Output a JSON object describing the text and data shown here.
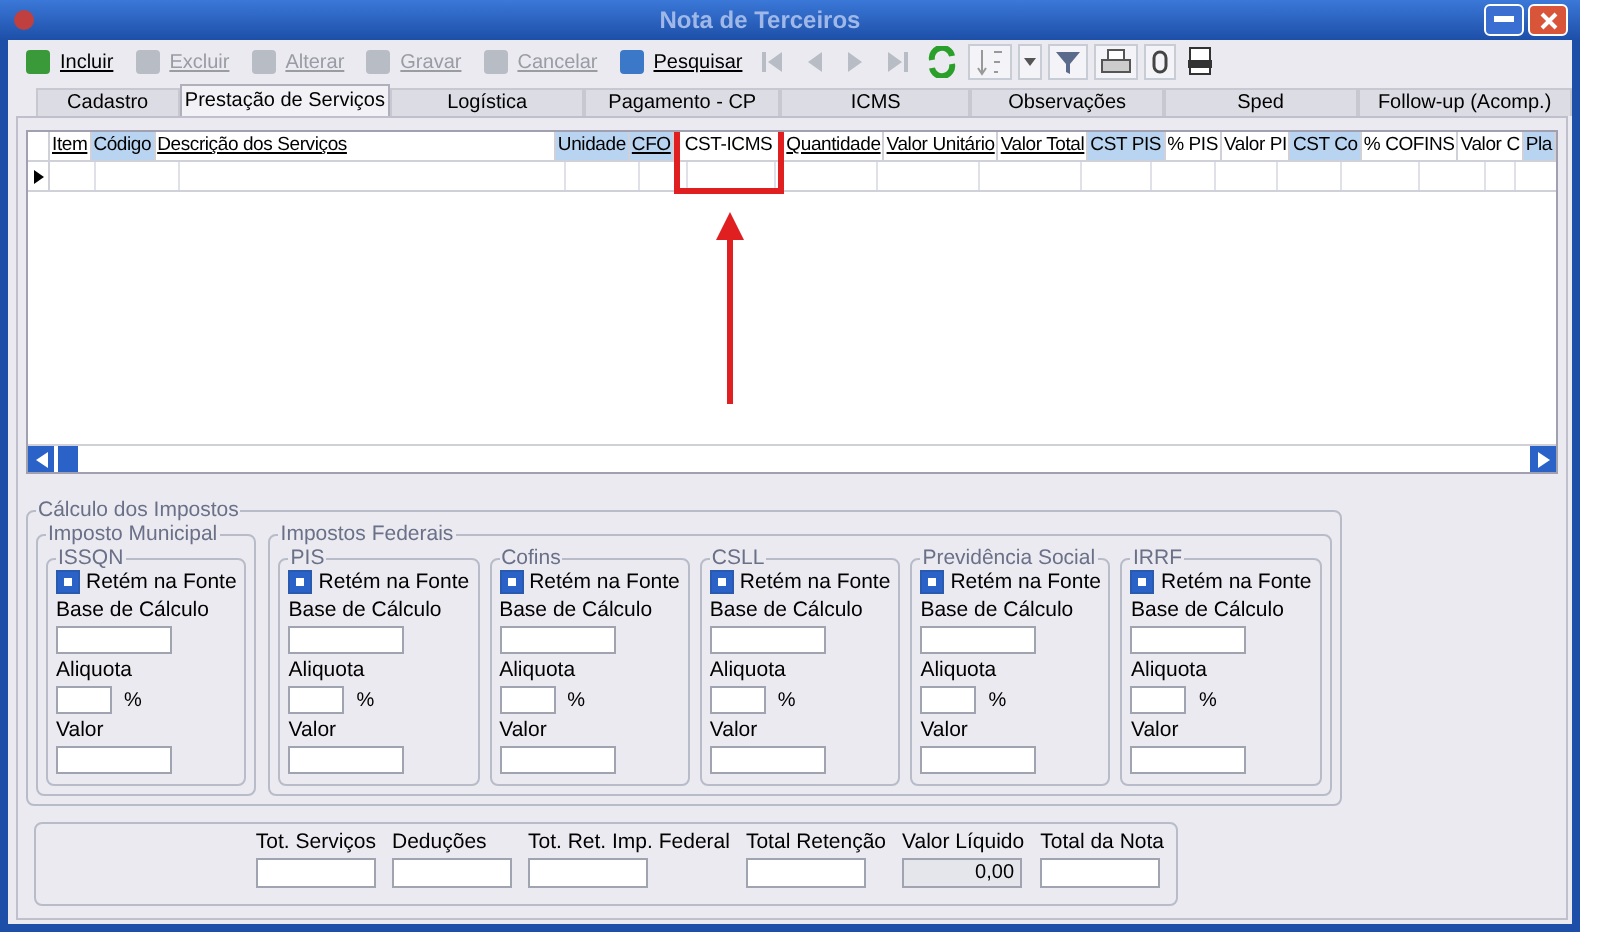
{
  "window": {
    "title": "Nota de Terceiros"
  },
  "toolbar": [
    {
      "label": "Incluir",
      "disabled": false
    },
    {
      "label": "Excluir",
      "disabled": true
    },
    {
      "label": "Alterar",
      "disabled": true
    },
    {
      "label": "Gravar",
      "disabled": true
    },
    {
      "label": "Cancelar",
      "disabled": true
    },
    {
      "label": "Pesquisar",
      "disabled": false
    }
  ],
  "tabs": [
    {
      "label": "Cadastro",
      "selected": false
    },
    {
      "label": "Prestação de Serviços",
      "selected": true
    },
    {
      "label": "Logística",
      "selected": false
    },
    {
      "label": "Pagamento - CP",
      "selected": false
    },
    {
      "label": "ICMS",
      "selected": false
    },
    {
      "label": "Observações",
      "selected": false
    },
    {
      "label": "Sped",
      "selected": false
    },
    {
      "label": "Follow-up (Acomp.)",
      "selected": false
    }
  ],
  "table": {
    "columns": [
      {
        "label": "Item",
        "sortable": true,
        "highlighted": false
      },
      {
        "label": "Código",
        "sortable": false,
        "highlighted": true
      },
      {
        "label": "Descrição dos Serviços",
        "sortable": true,
        "highlighted": false
      },
      {
        "label": "Unidade",
        "sortable": false,
        "highlighted": true
      },
      {
        "label": "CFO",
        "sortable": true,
        "highlighted": true
      },
      {
        "label": "CST-ICMS",
        "sortable": false,
        "highlighted": false
      },
      {
        "label": "Quantidade",
        "sortable": true,
        "highlighted": false
      },
      {
        "label": "Valor Unitário",
        "sortable": true,
        "highlighted": false
      },
      {
        "label": "Valor Total",
        "sortable": true,
        "highlighted": false
      },
      {
        "label": "CST PIS",
        "sortable": false,
        "highlighted": true
      },
      {
        "label": "% PIS",
        "sortable": false,
        "highlighted": false
      },
      {
        "label": "Valor PI",
        "sortable": false,
        "highlighted": false
      },
      {
        "label": "CST Co",
        "sortable": false,
        "highlighted": true
      },
      {
        "label": "% COFINS",
        "sortable": false,
        "highlighted": false
      },
      {
        "label": "Valor C",
        "sortable": false,
        "highlighted": false
      },
      {
        "label": "Pla",
        "sortable": false,
        "highlighted": true
      }
    ]
  },
  "taxes": {
    "title": "Cálculo dos Impostos",
    "groups": [
      {
        "title": "Imposto Municipal",
        "items": [
          {
            "title": "ISSQN",
            "checkbox": "Retém na Fonte",
            "checked": true,
            "base_label": "Base de Cálculo",
            "rate_label": "Aliquota",
            "percent": "%",
            "value_label": "Valor"
          }
        ]
      },
      {
        "title": "Impostos Federais",
        "items": [
          {
            "title": "PIS",
            "checkbox": "Retém na Fonte",
            "checked": true,
            "base_label": "Base de Cálculo",
            "rate_label": "Aliquota",
            "percent": "%",
            "value_label": "Valor"
          },
          {
            "title": "Cofins",
            "checkbox": "Retém na Fonte",
            "checked": true,
            "base_label": "Base de Cálculo",
            "rate_label": "Aliquota",
            "percent": "%",
            "value_label": "Valor"
          },
          {
            "title": "CSLL",
            "checkbox": "Retém na Fonte",
            "checked": true,
            "base_label": "Base de Cálculo",
            "rate_label": "Aliquota",
            "percent": "%",
            "value_label": "Valor"
          },
          {
            "title": "Previdência Social",
            "checkbox": "Retém na Fonte",
            "checked": true,
            "base_label": "Base de Cálculo",
            "rate_label": "Aliquota",
            "percent": "%",
            "value_label": "Valor"
          },
          {
            "title": "IRRF",
            "checkbox": "Retém na Fonte",
            "checked": true,
            "base_label": "Base de Cálculo",
            "rate_label": "Aliquota",
            "percent": "%",
            "value_label": "Valor"
          }
        ]
      }
    ]
  },
  "totals": [
    {
      "label": "Tot. Serviços"
    },
    {
      "label": "Deduções"
    },
    {
      "label": "Tot. Ret. Imp. Federal"
    },
    {
      "label": "Total Retenção"
    },
    {
      "label": "Valor Líquido",
      "value": "0,00"
    },
    {
      "label": "Total da Nota"
    }
  ]
}
